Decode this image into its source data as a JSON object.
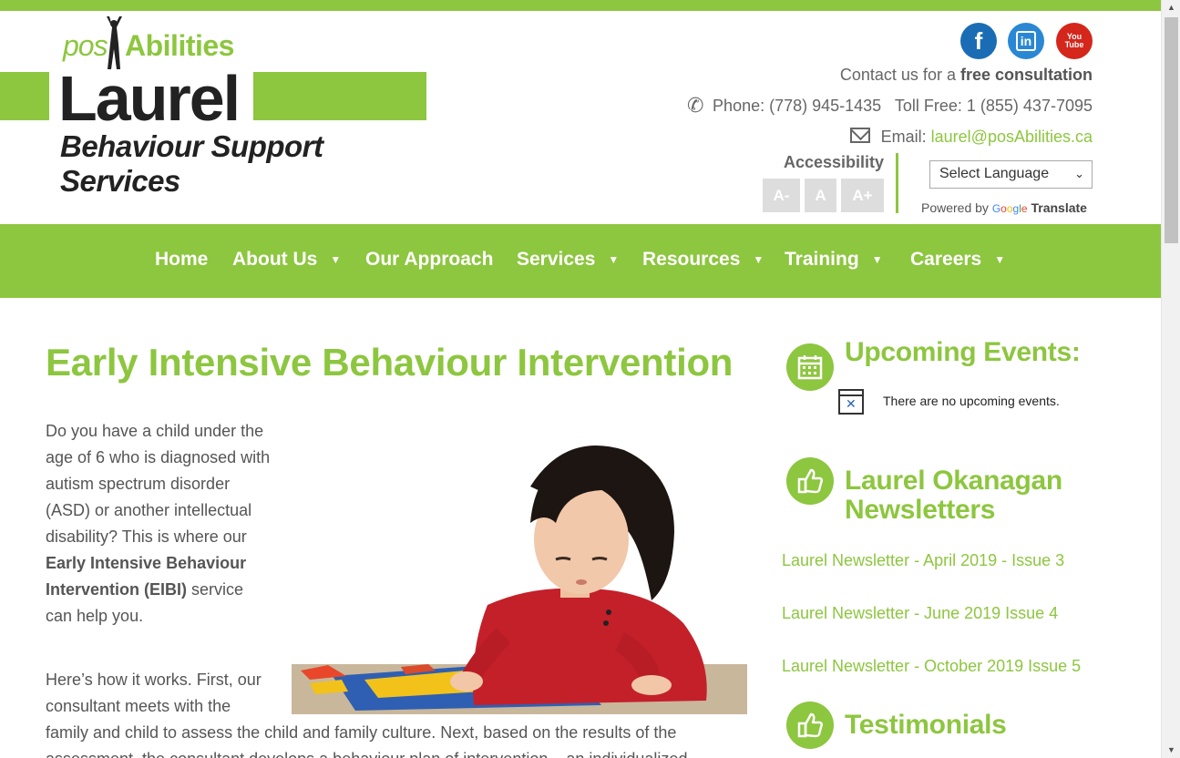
{
  "logo": {
    "pos": "pos",
    "abilities": "Abilities",
    "laurel": "Laurel",
    "subtitle": "Behaviour Support Services"
  },
  "social": {
    "facebook": "f",
    "linkedin": "in",
    "youtube_top": "You",
    "youtube_bottom": "Tube"
  },
  "contact": {
    "line1_prefix": "Contact us for a ",
    "line1_bold": "free consultation",
    "phone": "Phone: (778) 945-1435   Toll Free: 1 (855) 437-7095",
    "email_label": "Email: ",
    "email": "laurel@posAbilities.ca"
  },
  "accessibility": {
    "title": "Accessibility",
    "decrease": "A-",
    "normal": "A",
    "increase": "A+"
  },
  "translate": {
    "select_label": "Select Language",
    "powered_by": "Powered by ",
    "google": "Google",
    "translate": "Translate"
  },
  "nav": {
    "home": "Home",
    "about": "About Us",
    "approach": "Our Approach",
    "services": "Services",
    "resources": "Resources",
    "training": "Training",
    "careers": "Careers"
  },
  "main": {
    "title": "Early Intensive Behaviour Intervention",
    "p1_start": "Do you have a child under the age of 6 who is diagnosed with autism spectrum disorder (ASD) or another intellectual disability? This is where our ",
    "p1_bold": "Early Intensive Behaviour Intervention (EIBI)",
    "p1_end": " service can help you.",
    "p2": "Here’s how it works. First, our consultant meets with the",
    "p3": "family and child to assess the child and family culture. Next, based on the results of the assessment, the consultant develops a behaviour plan of intervention – an individualized"
  },
  "sidebar": {
    "events_title": "Upcoming Events:",
    "no_events": "There are no upcoming events.",
    "newsletters_title_1": "Laurel Okanagan",
    "newsletters_title_2": "Newsletters",
    "newsletters": [
      "Laurel Newsletter - April 2019 - Issue 3",
      "Laurel Newsletter - June 2019 Issue 4",
      "Laurel Newsletter - October 2019 Issue 5"
    ],
    "testimonials_title": "Testimonials"
  },
  "colors": {
    "brand_green": "#8dc63f",
    "text_gray": "#555555",
    "facebook_blue": "#1a6db4",
    "linkedin_blue": "#2a87d4",
    "youtube_red": "#d4261b"
  }
}
